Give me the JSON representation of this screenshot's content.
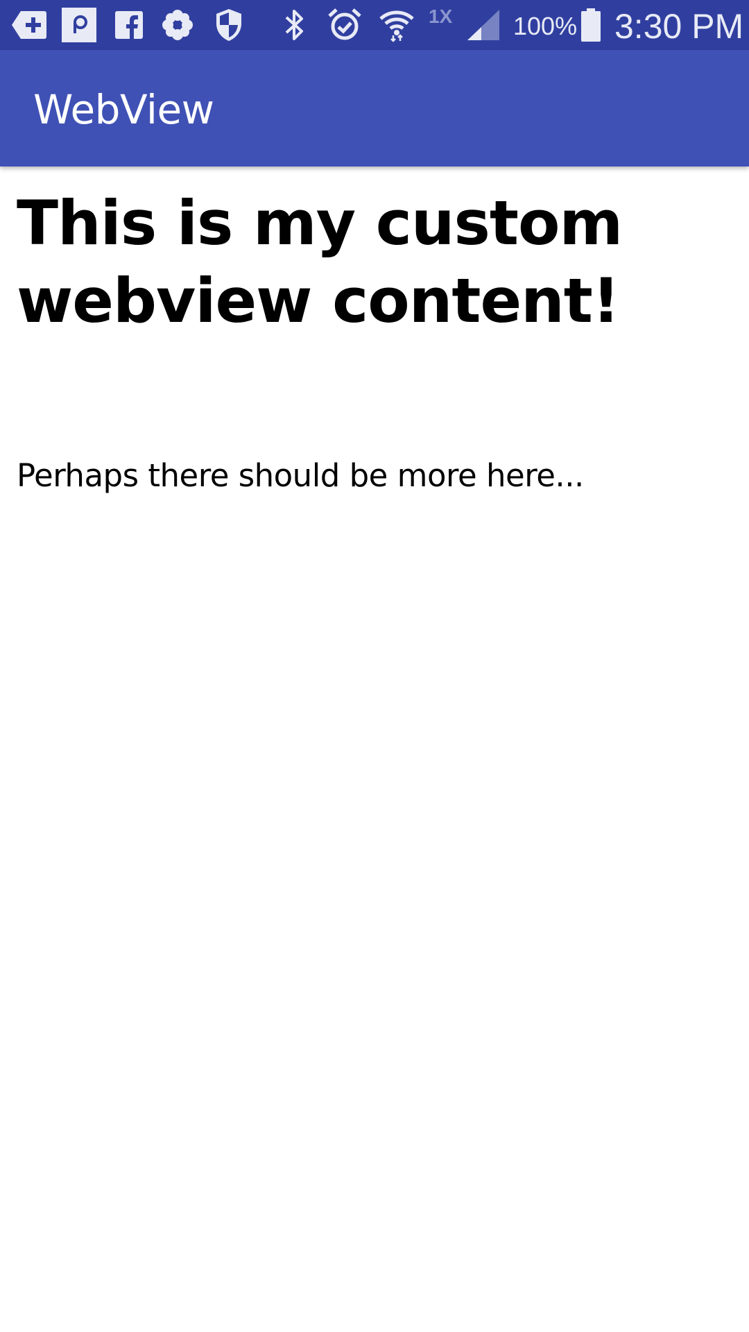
{
  "status_bar": {
    "icons": [
      "tag-plus-icon",
      "p-app-icon",
      "facebook-icon",
      "flower-icon",
      "shield-icon",
      "bluetooth-icon",
      "alarm-icon",
      "wifi-icon",
      "signal-icon",
      "battery-icon"
    ],
    "network_type": "1X",
    "battery_percent": "100%",
    "time": "3:30 PM"
  },
  "app_bar": {
    "title": "WebView"
  },
  "web_content": {
    "heading": "This is my custom webview content!",
    "paragraph": "Perhaps there should be more here..."
  },
  "colors": {
    "status_bar": "#303F9F",
    "app_bar": "#3F51B5",
    "app_bar_text": "#FFFFFF",
    "status_icons": "#E8EAF6",
    "content_background": "#FFFFFF",
    "content_text": "#000000"
  }
}
